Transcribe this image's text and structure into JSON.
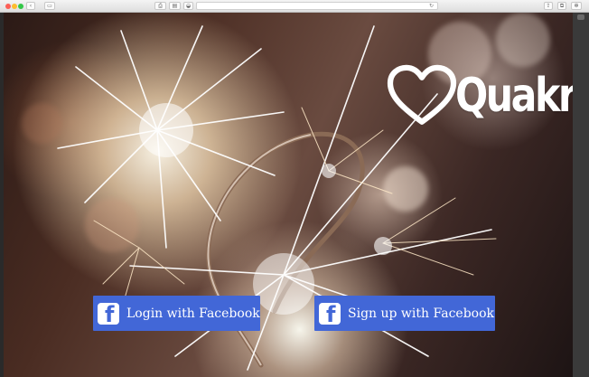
{
  "browser": {
    "back_glyph": "‹",
    "sidebar_glyph": "▭",
    "print_glyph": "⎙",
    "reader_glyph": "▤",
    "shield_glyph": "◒",
    "reload_glyph": "↻",
    "share_glyph": "⇪",
    "tabs_glyph": "⧉",
    "ext_glyph": "✻"
  },
  "brand": {
    "name": "Quakr",
    "heart_color": "#ffffff"
  },
  "actions": {
    "login_label": "Login with Facebook",
    "signup_label": "Sign up with Facebook",
    "fb_glyph": "f",
    "button_color": "#4267d7"
  }
}
